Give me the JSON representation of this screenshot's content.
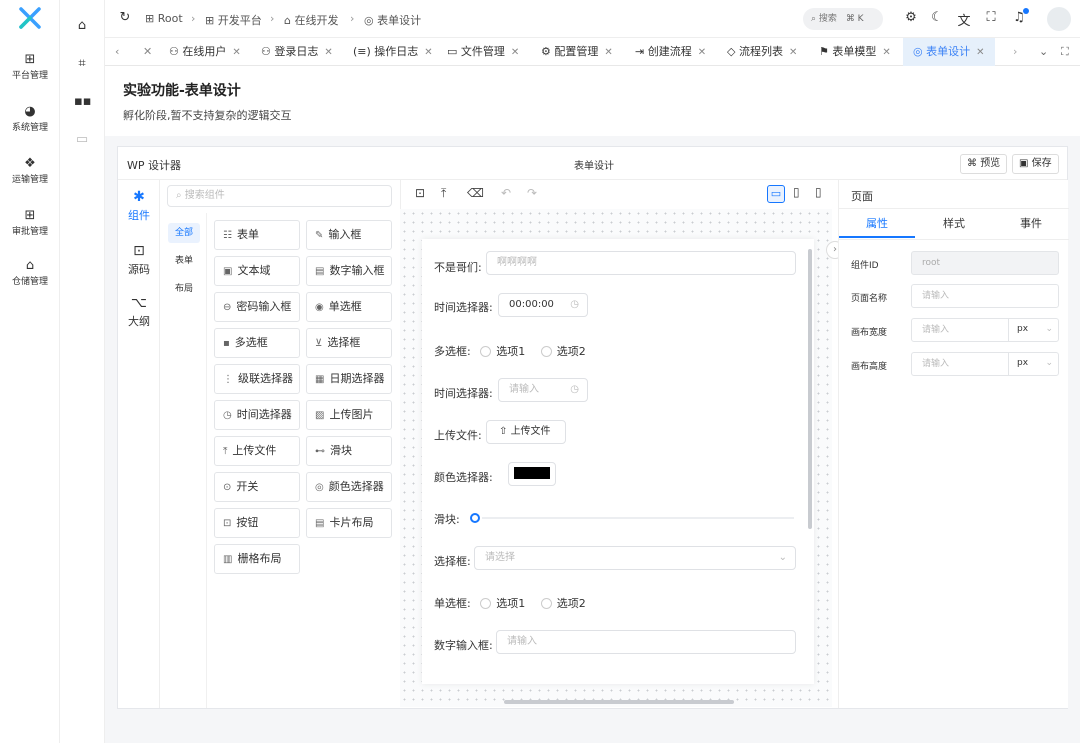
{
  "rail": {
    "items": [
      {
        "label": "平台管理",
        "icon": "platform-icon"
      },
      {
        "label": "系统管理",
        "icon": "dashboard-icon"
      },
      {
        "label": "运输管理",
        "icon": "dropbox-icon"
      },
      {
        "label": "审批管理",
        "icon": "grid-icon"
      },
      {
        "label": "仓储管理",
        "icon": "home-icon"
      }
    ]
  },
  "header": {
    "crumbs": [
      "Root",
      "开发平台",
      "在线开发",
      "表单设计"
    ],
    "search_label": "搜索",
    "search_shortcut": "⌘ K",
    "accent": "#1677ff"
  },
  "tabs": [
    {
      "label": "在线用户"
    },
    {
      "label": "登录日志"
    },
    {
      "label": "操作日志"
    },
    {
      "label": "文件管理"
    },
    {
      "label": "配置管理"
    },
    {
      "label": "创建流程"
    },
    {
      "label": "流程列表"
    },
    {
      "label": "表单模型"
    },
    {
      "label": "表单设计"
    }
  ],
  "page": {
    "title": "实验功能-表单设计",
    "subtitle": "孵化阶段,暂不支持复杂的逻辑交互"
  },
  "designer": {
    "name": "WP 设计器",
    "center_title": "表单设计",
    "preview": "预览",
    "save": "保存",
    "side_tabs": [
      "组件",
      "源码",
      "大纲"
    ],
    "search_placeholder": "搜索组件",
    "categories": [
      "全部",
      "表单",
      "布局"
    ],
    "components": [
      {
        "label": "表单",
        "icon": "☷"
      },
      {
        "label": "输入框",
        "icon": "✎"
      },
      {
        "label": "文本域",
        "icon": "▣"
      },
      {
        "label": "数字输入框",
        "icon": "▤"
      },
      {
        "label": "密码输入框",
        "icon": "🔒"
      },
      {
        "label": "单选框",
        "icon": "◉"
      },
      {
        "label": "多选框",
        "icon": "▪"
      },
      {
        "label": "选择框",
        "icon": "⌄"
      },
      {
        "label": "级联选择器",
        "icon": "⋮"
      },
      {
        "label": "日期选择器",
        "icon": "▦"
      },
      {
        "label": "时间选择器",
        "icon": "◷"
      },
      {
        "label": "上传图片",
        "icon": "▨"
      },
      {
        "label": "上传文件",
        "icon": "⤒"
      },
      {
        "label": "滑块",
        "icon": "⊷"
      },
      {
        "label": "开关",
        "icon": "⊙"
      },
      {
        "label": "颜色选择器",
        "icon": "◎"
      },
      {
        "label": "按钮",
        "icon": "⊡"
      },
      {
        "label": "卡片布局",
        "icon": "▤"
      },
      {
        "label": "栅格布局",
        "icon": "▥"
      }
    ]
  },
  "form": {
    "fields": [
      {
        "label": "不是哥们:",
        "placeholder": "啊啊啊啊"
      },
      {
        "label": "时间选择器:",
        "value": "00:00:00"
      },
      {
        "label": "多选框:",
        "options": [
          "选项1",
          "选项2"
        ]
      },
      {
        "label": "时间选择器:",
        "placeholder": "请输入"
      },
      {
        "label": "上传文件:",
        "button": "上传文件"
      },
      {
        "label": "颜色选择器:",
        "color": "#000000"
      },
      {
        "label": "滑块:"
      },
      {
        "label": "选择框:",
        "placeholder": "请选择"
      },
      {
        "label": "单选框:",
        "options": [
          "选项1",
          "选项2"
        ]
      },
      {
        "label": "数字输入框:",
        "placeholder": "请输入"
      }
    ]
  },
  "props": {
    "header": "页面",
    "tabs": [
      "属性",
      "样式",
      "事件"
    ],
    "rows": [
      {
        "label": "组件ID",
        "value": "root"
      },
      {
        "label": "页面名称",
        "placeholder": "请输入"
      },
      {
        "label": "画布宽度",
        "placeholder": "请输入",
        "unit": "px"
      },
      {
        "label": "画布高度",
        "placeholder": "请输入",
        "unit": "px"
      }
    ]
  }
}
